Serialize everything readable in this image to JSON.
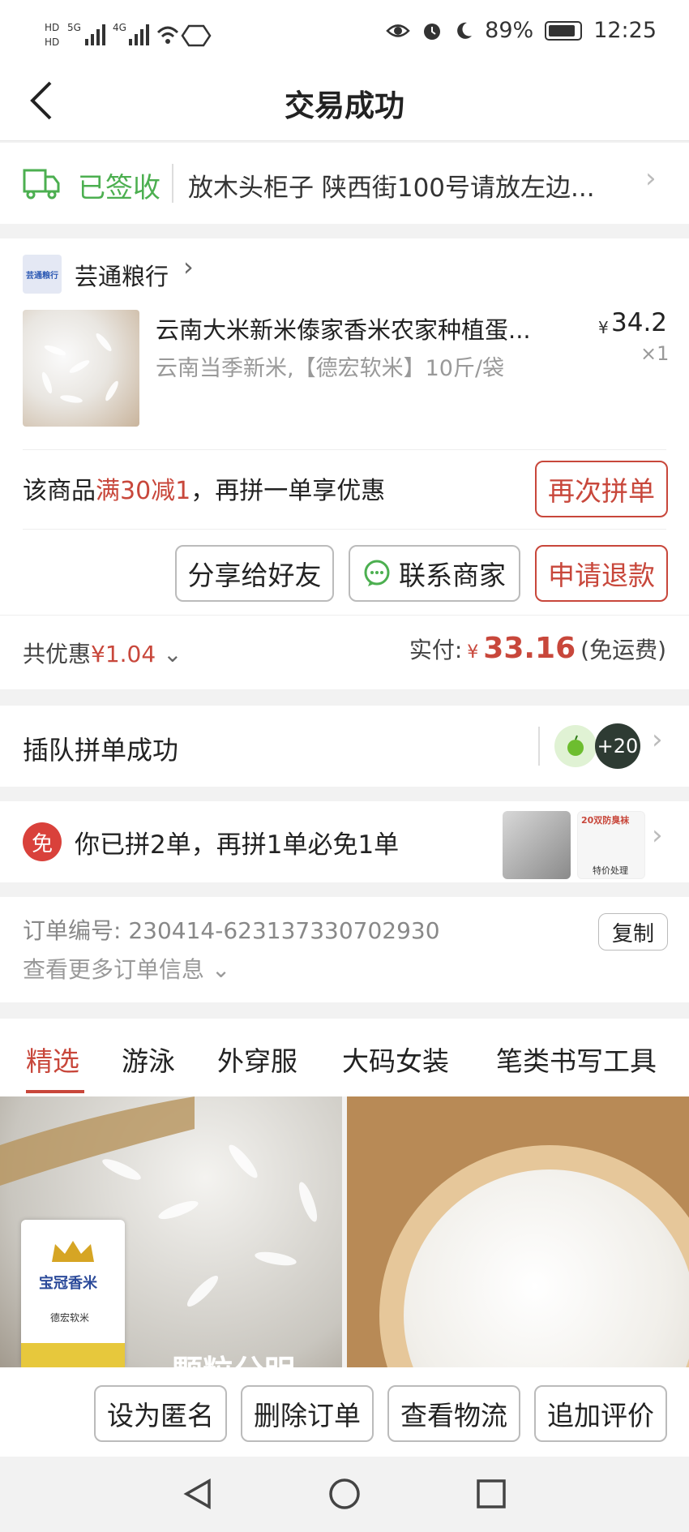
{
  "status_bar": {
    "left_icons": [
      "HD",
      "5G",
      "signal-bars",
      "4G",
      "signal-bars",
      "wifi-icon",
      "hand-icon"
    ],
    "battery": "89%",
    "time": "12:25",
    "right_icons": [
      "eye-icon",
      "alarm-icon",
      "moon-icon",
      "battery-icon"
    ]
  },
  "header": {
    "title": "交易成功"
  },
  "delivery": {
    "status": "已签收",
    "address": "放木头柜子 陕西街100号请放左边..."
  },
  "store": {
    "name": "芸通粮行",
    "logo_text": "芸通粮行",
    "product": {
      "title": "云南大米新米傣家香米农家种植蛋...",
      "spec": "云南当季新米,【德宏软米】10斤/袋",
      "price_symbol": "¥",
      "price": "34.2",
      "qty": "×1"
    },
    "promo": {
      "prefix": "该商品",
      "highlight": "满30减1",
      "suffix": "，再拼一单享优惠",
      "button": "再次拼单"
    },
    "actions": {
      "share": "分享给好友",
      "contact": "联系商家",
      "refund": "申请退款"
    }
  },
  "payment": {
    "discount_label": "共优惠",
    "discount_value": "¥1.04",
    "paid_label": "实付:",
    "currency": "¥",
    "paid": "33.16",
    "shipping": "(免运费)"
  },
  "group": {
    "label": "插队拼单成功",
    "count": "+20"
  },
  "free_order": {
    "badge": "免",
    "text": "你已拼2单，再拼1单必免1单",
    "thumb2_top": "20双防臭袜",
    "thumb2_bottom": "特价处理"
  },
  "order_info": {
    "number_label": "订单编号:",
    "number": "230414-623137330702930",
    "copy": "复制",
    "more": "查看更多订单信息"
  },
  "tabs": [
    "精选",
    "游泳",
    "外穿服",
    "大码女装",
    "笔类书写工具"
  ],
  "feed": {
    "card1_overlay": "颗粒分明",
    "bag_brand": "宝冠香米",
    "bag_type": "德宏软米"
  },
  "bottom_actions": [
    "设为匿名",
    "删除订单",
    "查看物流",
    "追加评价"
  ],
  "colors": {
    "accent": "#c8473b",
    "green": "#4caf50"
  }
}
